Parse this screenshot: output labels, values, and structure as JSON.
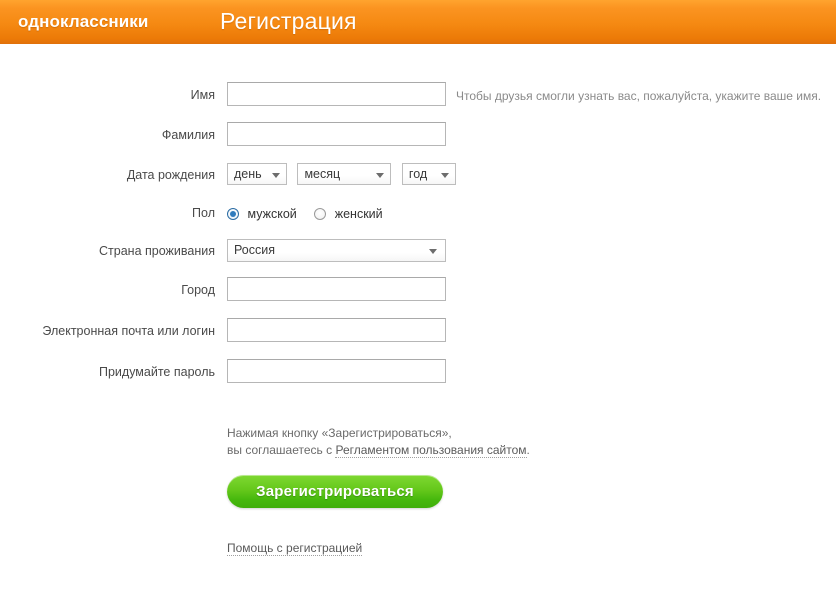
{
  "header": {
    "logo": "одноклассники",
    "title": "Регистрация",
    "bg_color_top": "#ffa42e",
    "bg_color_bottom": "#e0700a"
  },
  "form": {
    "rows": [
      {
        "label": "Имя",
        "type": "text",
        "value": "",
        "placeholder": "",
        "hint": "Чтобы друзья смогли узнать вас, пожалуйста, укажите ваше имя."
      },
      {
        "label": "Фамилия",
        "type": "text",
        "value": "",
        "placeholder": ""
      },
      {
        "label": "Дата рождения",
        "type": "date-selects",
        "day": "день",
        "month": "месяц",
        "year": "год"
      },
      {
        "label": "Пол",
        "type": "radio",
        "options": [
          {
            "label": "мужской",
            "checked": true
          },
          {
            "label": "женский",
            "checked": false
          }
        ]
      },
      {
        "label": "Страна проживания",
        "type": "select",
        "value": "Россия"
      },
      {
        "label": "Город",
        "type": "text",
        "value": "",
        "placeholder": ""
      },
      {
        "label": "Электронная почта или логин",
        "type": "text",
        "value": "",
        "placeholder": ""
      },
      {
        "label": "Придумайте пароль",
        "type": "password",
        "value": "",
        "placeholder": ""
      }
    ]
  },
  "terms": {
    "line1": "Нажимая кнопку «Зарегистрироваться»,",
    "line2_prefix": "вы соглашаетесь с ",
    "link": "Регламентом пользования сайтом",
    "line2_suffix": "."
  },
  "submit": {
    "label": "Зарегистрироваться",
    "color": "#56c313"
  },
  "help": {
    "link": "Помощь с регистрацией"
  },
  "icons": {
    "chevron_down": "chevron-down-icon",
    "radio_selected": "radio-selected-icon",
    "radio_unselected": "radio-unselected-icon"
  }
}
